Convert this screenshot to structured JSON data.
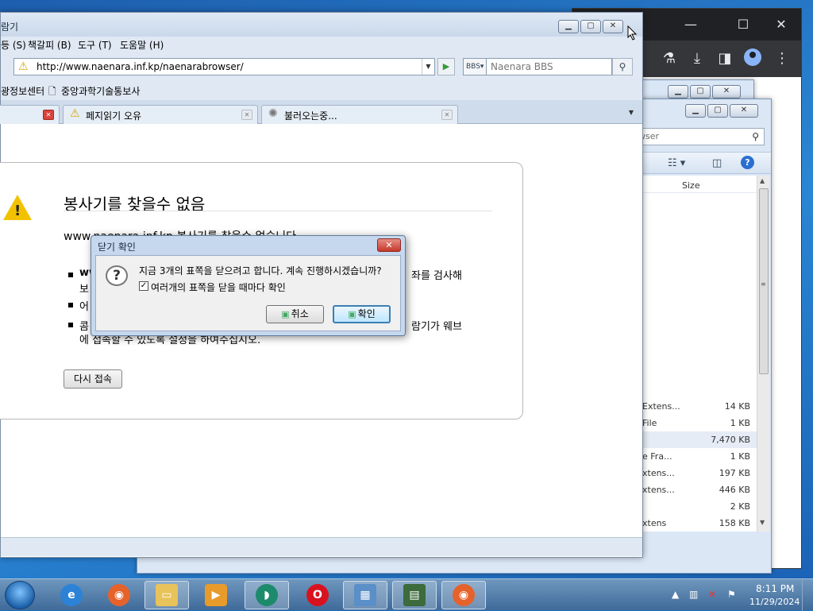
{
  "browser": {
    "title": "람기",
    "menu": [
      "등 (S)",
      "책갈피 (B)",
      "도구 (T)",
      "도움말 (H)"
    ],
    "url": "http://www.naenara.inf.kp/naenarabrowser/",
    "search_engine": "BBS",
    "search_placeholder": "Naenara BBS",
    "bookmarks": [
      "광정보센터",
      "중앙과학기술통보사"
    ],
    "tabs": [
      {
        "label": "",
        "icon": "error-icon"
      },
      {
        "label": "페지읽기 오유",
        "icon": "warning-icon"
      },
      {
        "label": "불러오는중...",
        "icon": "loading-icon"
      }
    ]
  },
  "error_page": {
    "heading": "봉사기를 찾을수 없음",
    "subtitle": "www.naenara.inf.kp 봉사기를 찾을수 없습니다",
    "bullets": [
      {
        "line1": "ww",
        "line1_end": "좌를 검사해",
        "line2": "보"
      },
      {
        "line1": "어"
      },
      {
        "line1": "콤",
        "line1_end": "람기가 웨브",
        "line2": "에 접속할 수 있도록 설정을 하여주십시오."
      }
    ],
    "retry_label": "다시 접속"
  },
  "dialog": {
    "title": "닫기 확인",
    "message": "지금 3개의 표쪽을 닫으려고 합니다. 계속 진행하시겠습니까?",
    "checkbox_label": "여러개의 표쪽을 닫을 때마다 확인",
    "checkbox_checked": true,
    "cancel_label": "취소",
    "ok_label": "확인"
  },
  "explorer": {
    "search_text": "wser",
    "size_header": "Size",
    "rows": [
      {
        "name": "Extens...",
        "size": "14 KB"
      },
      {
        "name": "File",
        "size": "1 KB"
      },
      {
        "name": "",
        "size": "7,470 KB",
        "selected": true
      },
      {
        "name": "e Fra...",
        "size": "1 KB"
      },
      {
        "name": "xtens...",
        "size": "197 KB"
      },
      {
        "name": "xtens...",
        "size": "446 KB"
      },
      {
        "name": "",
        "size": "2 KB"
      },
      {
        "name": "xtens",
        "size": "158 KB"
      }
    ]
  },
  "taskbar": {
    "time": "8:11 PM",
    "date": "11/29/2024",
    "apps": [
      "ie-icon",
      "firefox-icon",
      "explorer-icon",
      "media-icon",
      "browser-icon",
      "opera-icon",
      "control-panel-icon",
      "task-manager-icon",
      "firefox-icon"
    ]
  },
  "colors": {
    "titlebar": "#dfe9f5",
    "dialog_frame": "#c5d8ee",
    "close_red": "#c7382c",
    "taskbar": "#3f6a99"
  }
}
